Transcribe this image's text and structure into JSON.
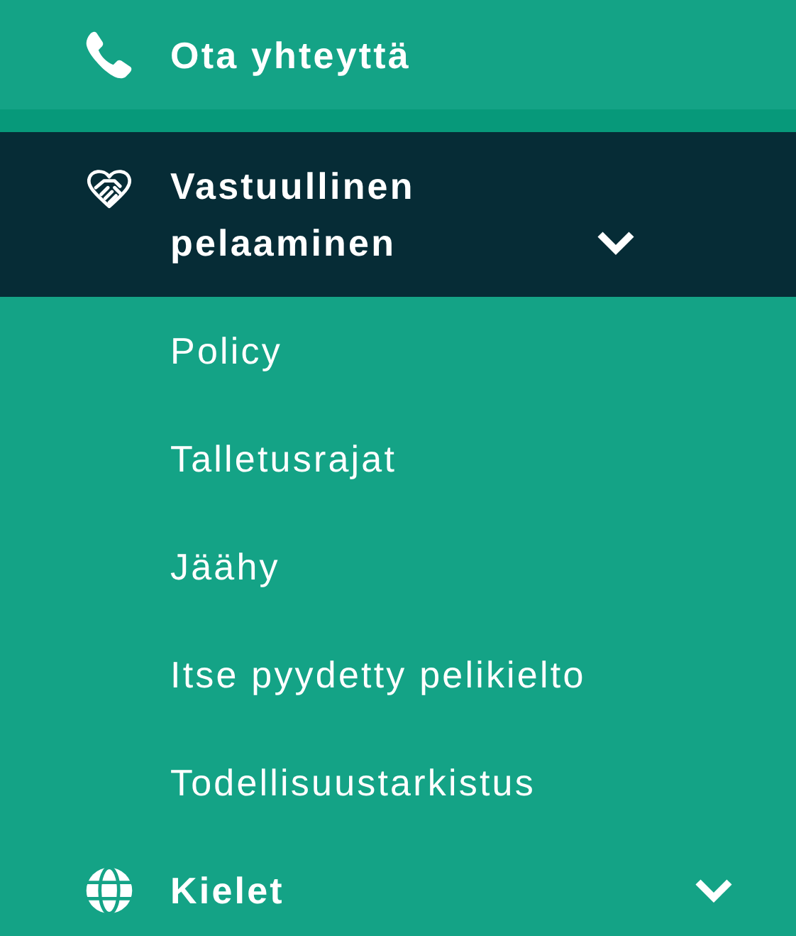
{
  "menu": {
    "items": [
      {
        "label": "Ota yhteyttä",
        "selected": false,
        "expandable": false
      },
      {
        "label": "Vastuullinen pelaaminen",
        "selected": true,
        "expandable": true,
        "children": [
          {
            "label": "Policy"
          },
          {
            "label": "Talletusrajat"
          },
          {
            "label": "Jäähy"
          },
          {
            "label": "Itse pyydetty pelikielto"
          },
          {
            "label": "Todellisuustarkistus"
          }
        ]
      },
      {
        "label": "Kielet",
        "selected": false,
        "expandable": true
      }
    ]
  }
}
